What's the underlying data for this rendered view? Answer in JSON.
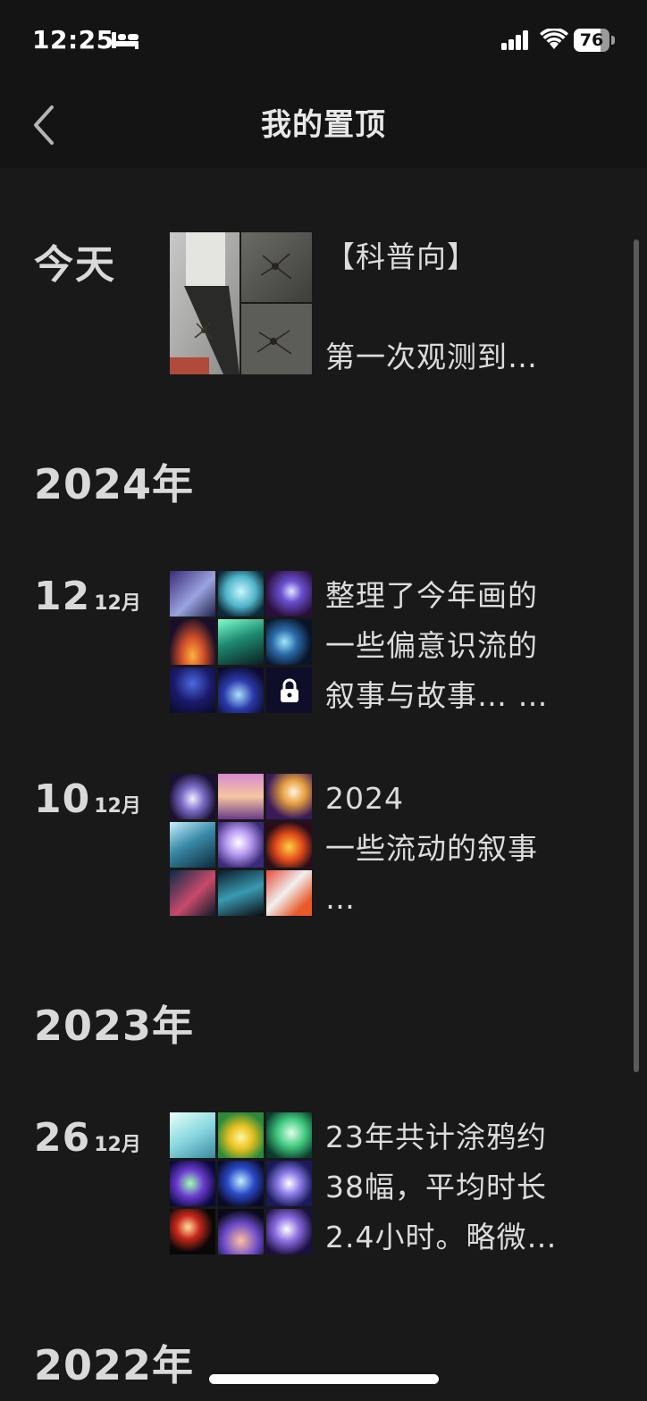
{
  "status_bar": {
    "time": "12:25",
    "battery_percent": "76",
    "battery_level": 0.76,
    "icons": [
      "bed-icon",
      "signal-icon",
      "wifi-icon",
      "battery-icon"
    ]
  },
  "nav": {
    "title": "我的置顶",
    "back_icon": "chevron-left-icon"
  },
  "sections": {
    "today": {
      "label": "今天",
      "post": {
        "line1": "【科普向】",
        "line2": "",
        "line3": "第一次观测到…"
      }
    },
    "y2024": {
      "heading": "2024年",
      "posts": [
        {
          "day": "12",
          "month": "12月",
          "lines": [
            "整理了今年画的",
            "一些偏意识流的",
            "叙事与故事… …"
          ],
          "has_lock": true
        },
        {
          "day": "10",
          "month": "12月",
          "lines": [
            "2024",
            "一些流动的叙事",
            "…"
          ]
        }
      ]
    },
    "y2023": {
      "heading": "2023年",
      "posts": [
        {
          "day": "26",
          "month": "12月",
          "lines": [
            "23年共计涂鸦约",
            "38幅，平均时长",
            "2.4小时。略微…"
          ]
        }
      ]
    },
    "y2022": {
      "heading": "2022年"
    }
  },
  "colors": {
    "background": "#191919",
    "header": "#141414",
    "text": "#dcdcdc"
  }
}
